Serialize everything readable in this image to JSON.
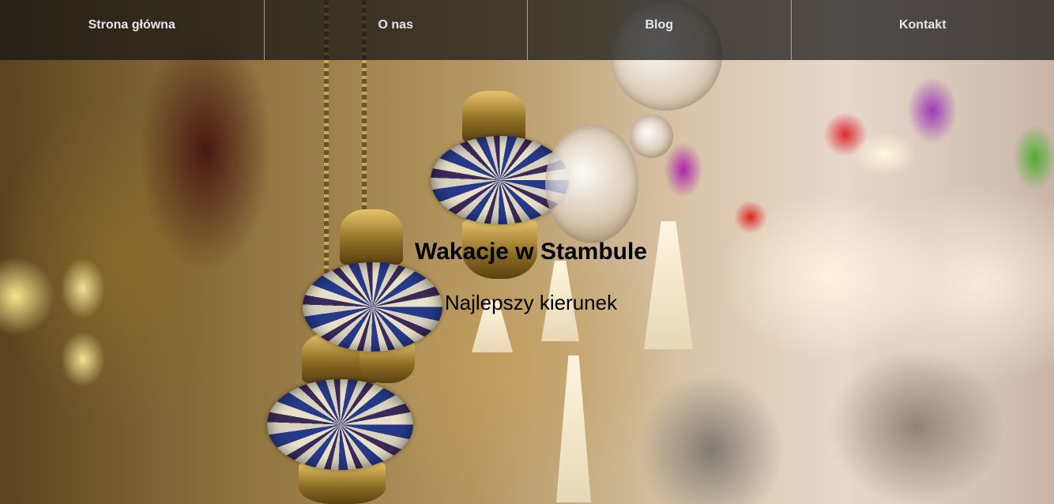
{
  "nav": {
    "items": [
      {
        "label": "Strona główna"
      },
      {
        "label": "O nas"
      },
      {
        "label": "Blog"
      },
      {
        "label": "Kontakt"
      }
    ]
  },
  "hero": {
    "title": "Wakacje w Stambule",
    "subtitle": "Najlepszy kierunek"
  },
  "background": {
    "image_description_icon": "lanterns-photo",
    "nav_overlay_color": "#141414"
  }
}
